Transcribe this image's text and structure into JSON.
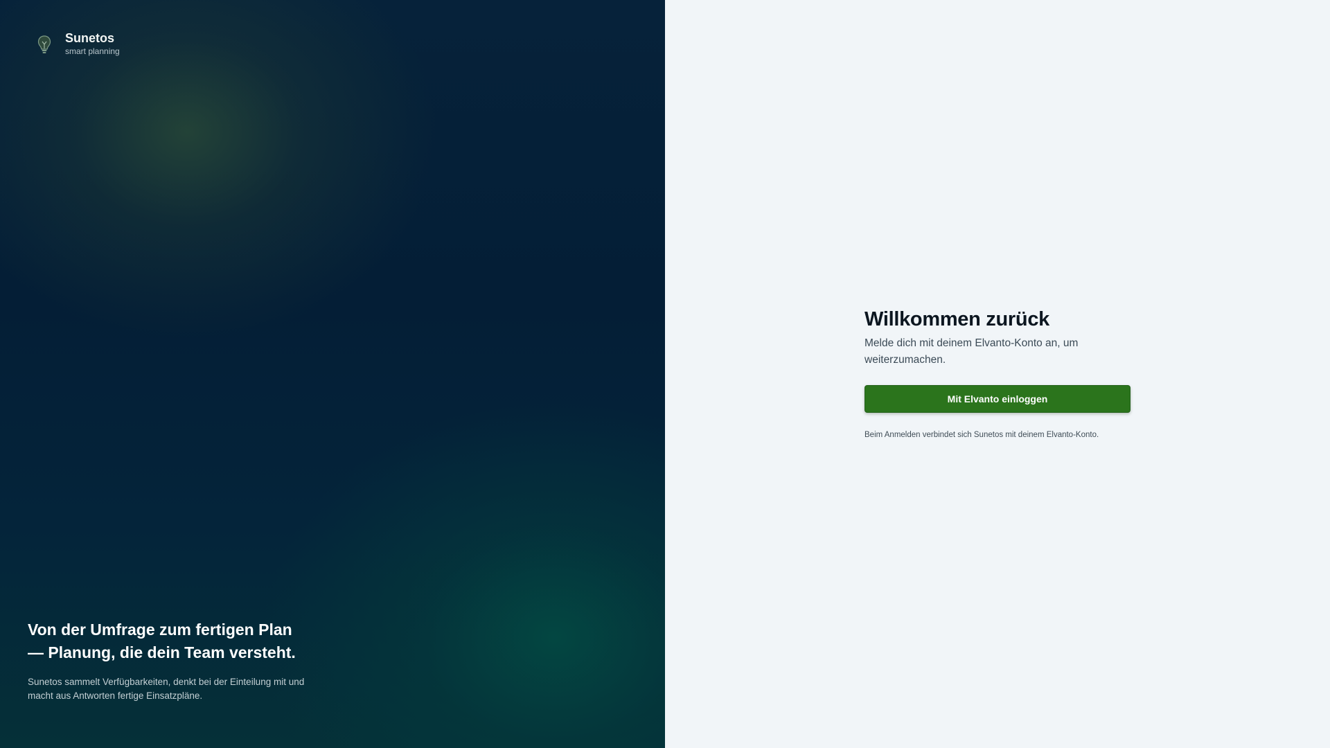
{
  "brand": {
    "name": "Sunetos",
    "tagline": "smart planning",
    "logo_icon": "lightbulb-icon"
  },
  "hero": {
    "headline_line1": "Von der Umfrage zum fertigen Plan",
    "headline_line2": "— Planung, die dein Team versteht.",
    "text_line1": "Sunetos sammelt Verfügbarkeiten, denkt bei der Einteilung mit und",
    "text_line2": "macht aus Antworten fertige Einsatzpläne."
  },
  "login": {
    "title": "Willkommen zurück",
    "subtitle_line1": "Melde dich mit deinem Elvanto-Konto an, um",
    "subtitle_line2": "weiterzumachen.",
    "button_label": "Mit Elvanto einloggen",
    "footnote": "Beim Anmelden verbindet sich Sunetos mit deinem Elvanto-Konto."
  },
  "colors": {
    "left_panel_base": "#06223a",
    "accent_green_glow": "#284837",
    "accent_teal_glow": "#03483f",
    "right_panel_bg": "#f1f5f8",
    "button_bg": "#2b741c",
    "title_text": "#0c1620"
  }
}
